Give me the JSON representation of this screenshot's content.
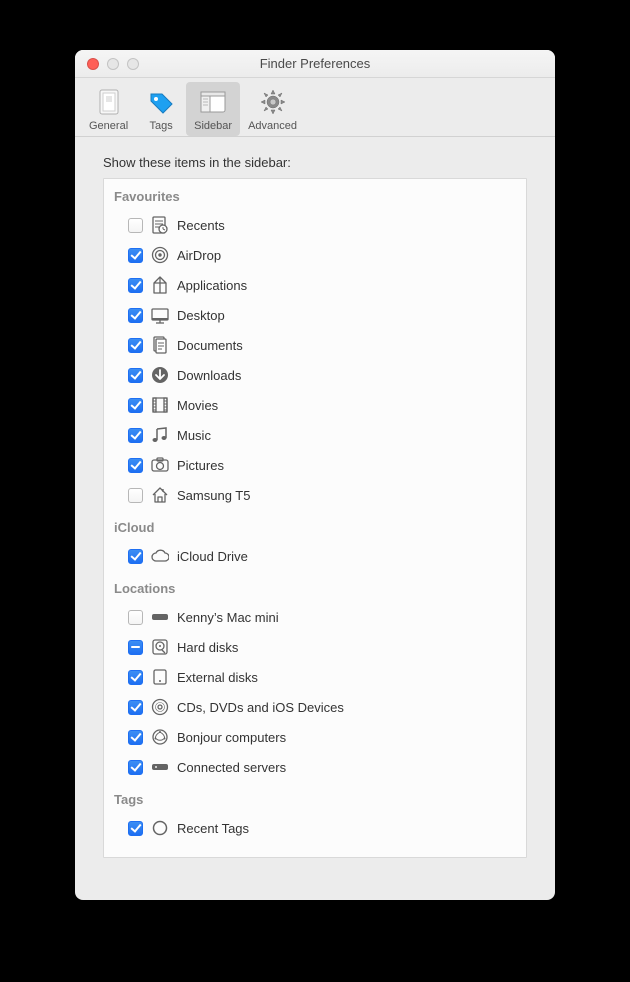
{
  "window_title": "Finder Preferences",
  "toolbar": [
    {
      "id": "general",
      "label": "General",
      "selected": false
    },
    {
      "id": "tags",
      "label": "Tags",
      "selected": false
    },
    {
      "id": "sidebar",
      "label": "Sidebar",
      "selected": true
    },
    {
      "id": "advanced",
      "label": "Advanced",
      "selected": false
    }
  ],
  "heading": "Show these items in the sidebar:",
  "sections": [
    {
      "title": "Favourites",
      "items": [
        {
          "checked": false,
          "icon": "clock-doc",
          "label": "Recents"
        },
        {
          "checked": true,
          "icon": "airdrop",
          "label": "AirDrop"
        },
        {
          "checked": true,
          "icon": "apps",
          "label": "Applications"
        },
        {
          "checked": true,
          "icon": "desktop",
          "label": "Desktop"
        },
        {
          "checked": true,
          "icon": "documents",
          "label": "Documents"
        },
        {
          "checked": true,
          "icon": "downloads",
          "label": "Downloads"
        },
        {
          "checked": true,
          "icon": "movies",
          "label": "Movies"
        },
        {
          "checked": true,
          "icon": "music",
          "label": "Music"
        },
        {
          "checked": true,
          "icon": "pictures",
          "label": "Pictures"
        },
        {
          "checked": false,
          "icon": "home",
          "label": "Samsung T5"
        }
      ]
    },
    {
      "title": "iCloud",
      "items": [
        {
          "checked": true,
          "icon": "cloud",
          "label": "iCloud Drive"
        }
      ]
    },
    {
      "title": "Locations",
      "items": [
        {
          "checked": false,
          "icon": "macmini",
          "label": "Kenny’s Mac mini"
        },
        {
          "checked": "mixed",
          "icon": "hdd",
          "label": "Hard disks"
        },
        {
          "checked": true,
          "icon": "external",
          "label": "External disks"
        },
        {
          "checked": true,
          "icon": "disc",
          "label": "CDs, DVDs and iOS Devices"
        },
        {
          "checked": true,
          "icon": "bonjour",
          "label": "Bonjour computers"
        },
        {
          "checked": true,
          "icon": "server",
          "label": "Connected servers"
        }
      ]
    },
    {
      "title": "Tags",
      "items": [
        {
          "checked": true,
          "icon": "circle",
          "label": "Recent Tags"
        }
      ]
    }
  ]
}
